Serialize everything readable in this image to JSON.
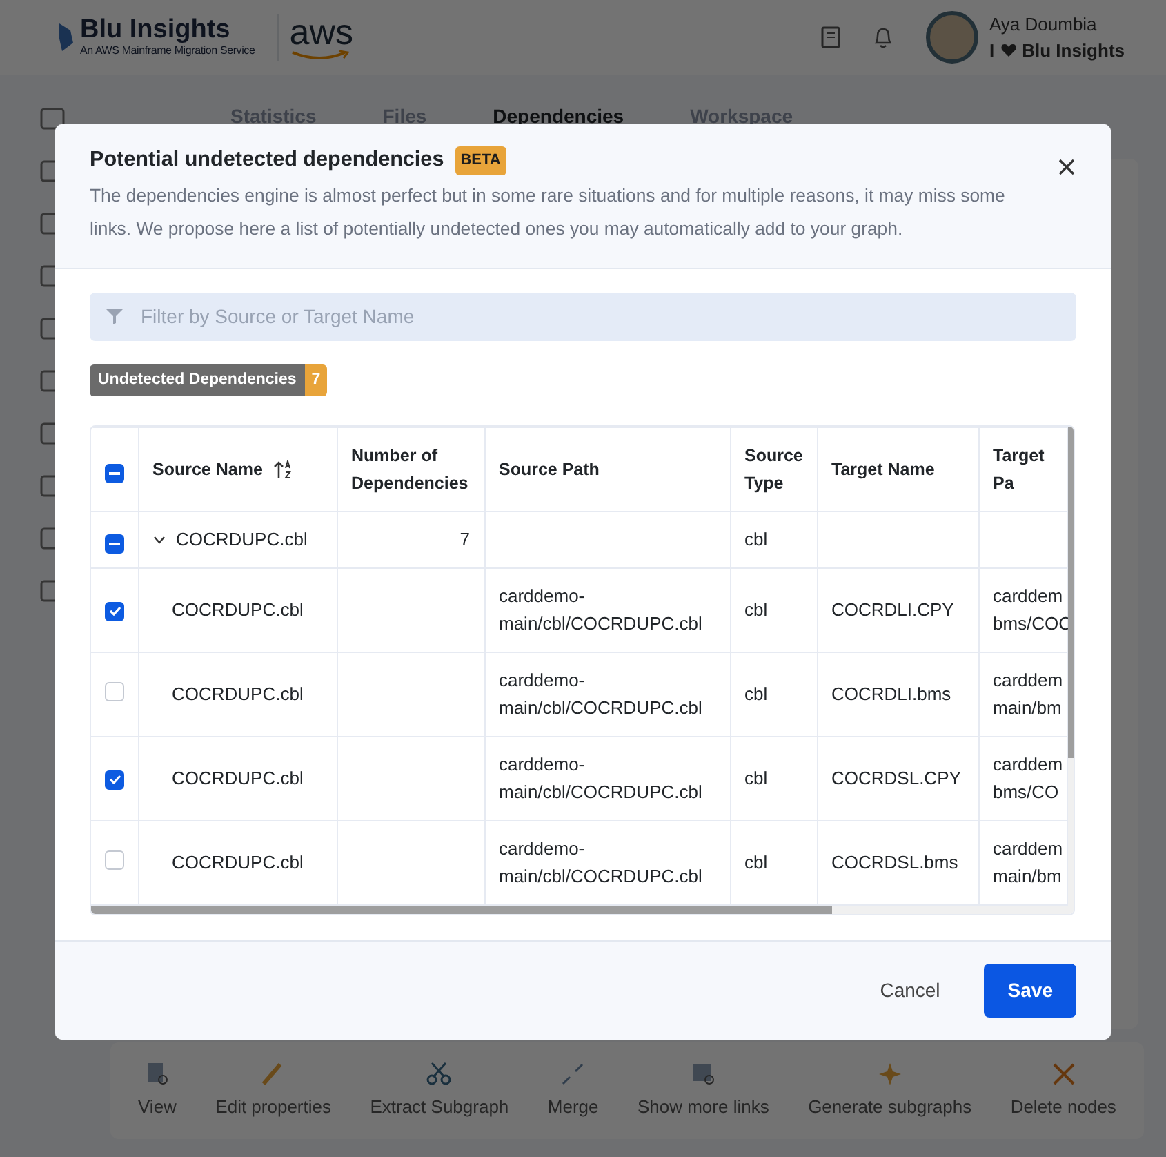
{
  "header": {
    "brand": "Blu Insights",
    "brand_subtitle": "An AWS Mainframe Migration Service",
    "partner_logo": "aws",
    "user": {
      "name": "Aya Doumbia",
      "tagline_start": "I",
      "tagline_end": "Blu Insights"
    }
  },
  "tabs": [
    {
      "label": "Statistics",
      "selected": false
    },
    {
      "label": "Files",
      "selected": false
    },
    {
      "label": "Dependencies",
      "selected": true
    },
    {
      "label": "Workspace",
      "selected": false
    }
  ],
  "toolbar": [
    {
      "label": "View",
      "kind": "view"
    },
    {
      "label": "Edit properties",
      "kind": "edit"
    },
    {
      "label": "Extract Subgraph",
      "kind": "cut"
    },
    {
      "label": "Merge",
      "kind": "merge"
    },
    {
      "label": "Show more links",
      "kind": "links"
    },
    {
      "label": "Generate subgraphs",
      "kind": "sparkle"
    },
    {
      "label": "Delete nodes",
      "kind": "delete"
    }
  ],
  "modal": {
    "title": "Potential undetected dependencies",
    "title_badge": "BETA",
    "description": "The dependencies engine is almost perfect but in some rare situations and for multiple reasons, it may miss some links. We propose here a list of potentially undetected ones you may automatically add to your graph.",
    "filter": {
      "placeholder": "Filter by Source or Target Name"
    },
    "counter": {
      "label": "Undetected Dependencies",
      "count": "7"
    },
    "table": {
      "select_all": {
        "indeterminate": true
      },
      "columns": [
        {
          "label": "Source Name",
          "sorted": true
        },
        {
          "label": "Number of Dependencies",
          "sorted": false
        },
        {
          "label": "Source Path",
          "sorted": false
        },
        {
          "label": "Source Type",
          "sorted": false
        },
        {
          "label": "Target Name",
          "sorted": false
        },
        {
          "label": "Target Pa",
          "sorted": false
        }
      ],
      "groups": [
        {
          "indeterminate": true,
          "expanded": true,
          "source_name": "COCRDUPC.cbl",
          "count": "7",
          "source_type": "cbl",
          "children": [
            {
              "checked": true,
              "source_name": "COCRDUPC.cbl",
              "source_path": "carddemo-main/cbl/COCRDUPC.cbl",
              "source_type": "cbl",
              "target_name": "COCRDLI.CPY",
              "target_path": "carddem bms/COC"
            },
            {
              "checked": false,
              "source_name": "COCRDUPC.cbl",
              "source_path": "carddemo-main/cbl/COCRDUPC.cbl",
              "source_type": "cbl",
              "target_name": "COCRDLI.bms",
              "target_path": "carddem main/bm"
            },
            {
              "checked": true,
              "source_name": "COCRDUPC.cbl",
              "source_path": "carddemo-main/cbl/COCRDUPC.cbl",
              "source_type": "cbl",
              "target_name": "COCRDSL.CPY",
              "target_path": "carddem bms/CO"
            },
            {
              "checked": false,
              "source_name": "COCRDUPC.cbl",
              "source_path": "carddemo-main/cbl/COCRDUPC.cbl",
              "source_type": "cbl",
              "target_name": "COCRDSL.bms",
              "target_path": "carddem main/bm"
            }
          ]
        }
      ]
    },
    "buttons": [
      {
        "label": "Cancel",
        "kind": "secondary"
      },
      {
        "label": "Save",
        "kind": "primary"
      }
    ]
  }
}
